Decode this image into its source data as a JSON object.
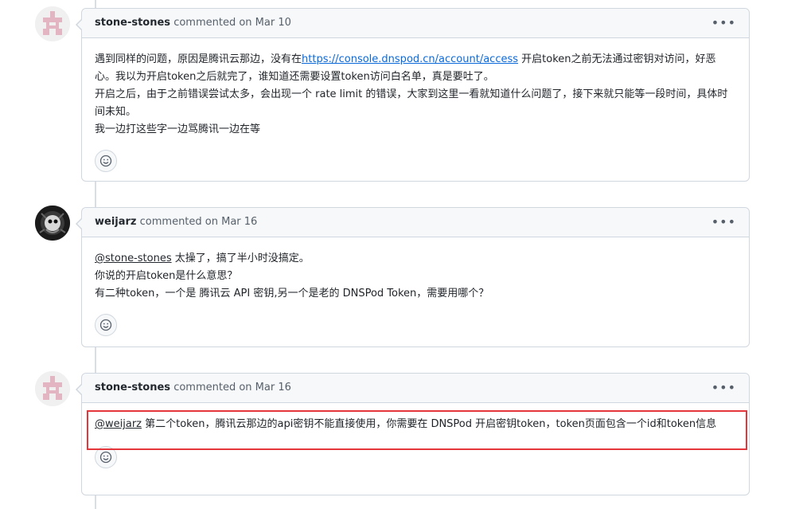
{
  "comments": [
    {
      "author": "stone-stones",
      "meta": "commented on Mar 10",
      "avatar_icon": "identicon-pink",
      "lines": [
        {
          "pre": "遇到同样的问题，原因是腾讯云那边，没有在",
          "link": "https://console.dnspod.cn/account/access",
          "post": " 开启token之前无法通过密钥对访问，好恶心。我以为开启token之后就完了，谁知道还需要设置token访问白名单，真是要吐了。"
        },
        {
          "text": "开启之后，由于之前错误尝试太多，会出现一个 rate limit 的错误，大家到这里一看就知道什么问题了，接下来就只能等一段时间，具体时间未知。"
        },
        {
          "text": "我一边打这些字一边骂腾讯一边在等"
        }
      ]
    },
    {
      "author": "weijarz",
      "meta": "commented on Mar 16",
      "avatar_icon": "avatar-dark",
      "mention": "@stone-stones",
      "lines": [
        {
          "text": " 太操了，搞了半小时没搞定。"
        },
        {
          "text": "你说的开启token是什么意思？"
        },
        {
          "text": "有二种token，一个是 腾讯云 API 密钥,另一个是老的 DNSPod Token，需要用哪个？"
        }
      ]
    },
    {
      "author": "stone-stones",
      "meta": "commented on Mar 16",
      "avatar_icon": "identicon-pink",
      "mention": "@weijarz",
      "lines": [
        {
          "text": " 第二个token，腾讯云那边的api密钥不能直接使用，你需要在 DNSPod 开启密钥token，token页面包含一个id和token信息"
        }
      ]
    }
  ],
  "icons": {
    "kebab": "kebab-horizontal-icon",
    "reaction": "smiley-icon"
  },
  "colors": {
    "highlight": "#e5363b",
    "link": "#0969da",
    "identicon": "#e3b4c2"
  }
}
